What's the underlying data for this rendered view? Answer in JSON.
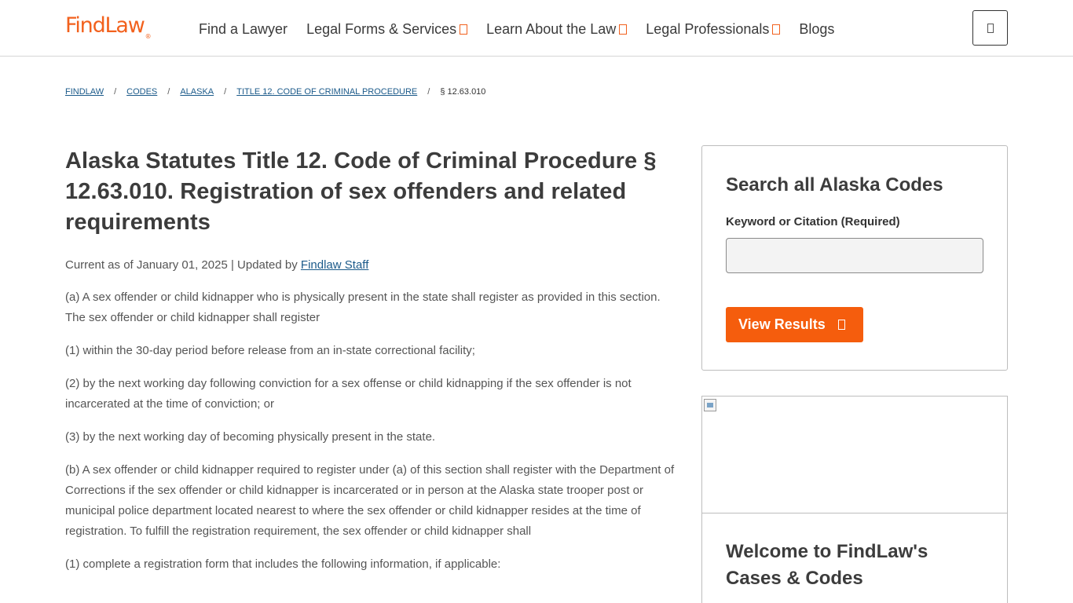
{
  "header": {
    "logo": "FindLaw",
    "logo_mark": "®",
    "nav": [
      {
        "label": "Find a Lawyer",
        "has_dropdown": false
      },
      {
        "label": "Legal Forms & Services",
        "has_dropdown": true
      },
      {
        "label": "Learn About the Law",
        "has_dropdown": true
      },
      {
        "label": "Legal Professionals",
        "has_dropdown": true
      },
      {
        "label": "Blogs",
        "has_dropdown": false
      }
    ],
    "menu_icon": "menu-icon"
  },
  "breadcrumb": {
    "items": [
      "FINDLAW",
      "CODES",
      "ALASKA",
      "TITLE 12. CODE OF CRIMINAL PROCEDURE"
    ],
    "separator": "/",
    "current": "§ 12.63.010"
  },
  "article": {
    "title": "Alaska Statutes Title 12. Code of Criminal Procedure § 12.63.010. Registration of sex offenders and related requirements",
    "meta_prefix": "Current as of January 01, 2025 | Updated by",
    "author": "Findlaw Staff",
    "paragraphs": [
      "(a) A sex offender or child kidnapper who is physically present in the state shall register as provided in this section. The sex offender or child kidnapper shall register",
      "(1) within the 30-day period before release from an in-state correctional facility;",
      "(2) by the next working day following conviction for a sex offense or child kidnapping if the sex offender is not incarcerated at the time of conviction; or",
      "(3) by the next working day of becoming physically present in the state.",
      "(b) A sex offender or child kidnapper required to register under (a) of this section shall register with the Department of Corrections if the sex offender or child kidnapper is incarcerated or in person at the Alaska state trooper post or municipal police department located nearest to where the sex offender or child kidnapper resides at the time of registration. To fulfill the registration requirement, the sex offender or child kidnapper shall",
      "(1) complete a registration form that includes the following information, if applicable:"
    ]
  },
  "sidebar": {
    "search": {
      "heading": "Search all Alaska Codes",
      "label": "Keyword or Citation (Required)",
      "value": "",
      "button_label": "View Results"
    },
    "promo": {
      "title": "Welcome to FindLaw's Cases & Codes"
    }
  },
  "colors": {
    "brand_orange": "#f2611d",
    "button_orange": "#f55d0d",
    "link_blue": "#1b5a8a"
  }
}
